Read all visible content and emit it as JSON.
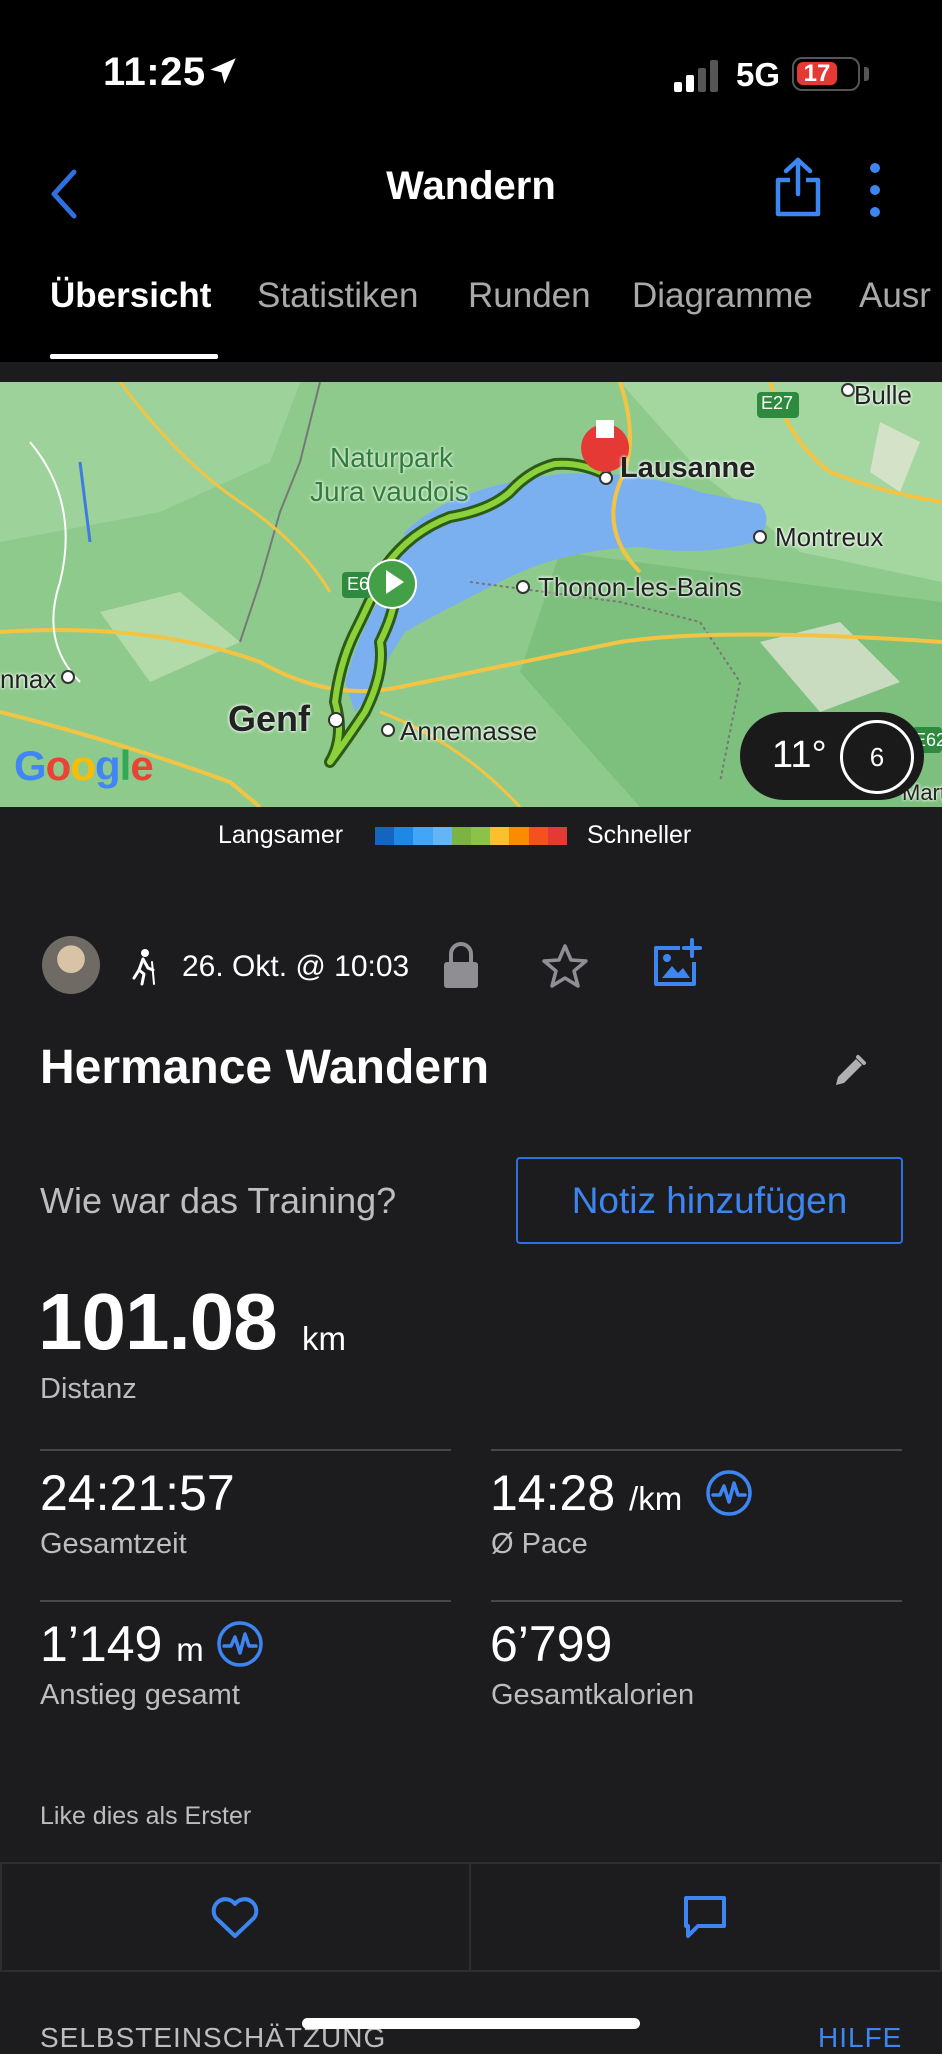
{
  "status_bar": {
    "time": "11:25",
    "network": "5G",
    "battery": "17"
  },
  "header": {
    "title": "Wandern"
  },
  "tabs": [
    {
      "label": "Übersicht",
      "active": true
    },
    {
      "label": "Statistiken",
      "active": false
    },
    {
      "label": "Runden",
      "active": false
    },
    {
      "label": "Diagramme",
      "active": false
    },
    {
      "label": "Ausr",
      "active": false
    }
  ],
  "map": {
    "labels": {
      "bulle": "Bulle",
      "e27": "E27",
      "lausanne": "Lausanne",
      "naturpark": "Naturpark",
      "jura": "Jura vaudois",
      "montreux": "Montreux",
      "thonon": "Thonon-les-Bains",
      "e6": "E6",
      "nnax": "nnax",
      "genf": "Genf",
      "annemasse": "Annemasse",
      "e62": "E62",
      "martig": "Martig"
    },
    "attribution": "Google",
    "weather": {
      "temperature": "11°",
      "wind_speed": "6"
    }
  },
  "legend": {
    "slower": "Langsamer",
    "faster": "Schneller",
    "colors": [
      "#1565c0",
      "#1e88e5",
      "#42a5f5",
      "#64b5f6",
      "#7cb342",
      "#8bc34a",
      "#fbc02d",
      "#fb8c00",
      "#f4511e",
      "#e53935"
    ]
  },
  "activity": {
    "date": "26. Okt. @ 10:03",
    "title": "Hermance Wandern",
    "question": "Wie war das Training?",
    "add_note": "Notiz hinzufügen"
  },
  "stats": {
    "distance": {
      "value": "101.08",
      "unit": "km",
      "label": "Distanz"
    },
    "total_time": {
      "value": "24:21:57",
      "label": "Gesamtzeit"
    },
    "pace": {
      "value": "14:28",
      "unit": "/km",
      "label": "Ø Pace"
    },
    "ascent": {
      "value": "1’149",
      "unit": "m",
      "label": "Anstieg gesamt"
    },
    "calories": {
      "value": "6’799",
      "label": "Gesamtkalorien"
    }
  },
  "social": {
    "like_first": "Like dies als Erster"
  },
  "footer": {
    "self_evaluation": "SELBSTEINSCHÄTZUNG",
    "help": "HILFE"
  },
  "colors": {
    "accent": "#3d86f2",
    "background": "#1c1c1e",
    "header_bg": "#000000"
  }
}
